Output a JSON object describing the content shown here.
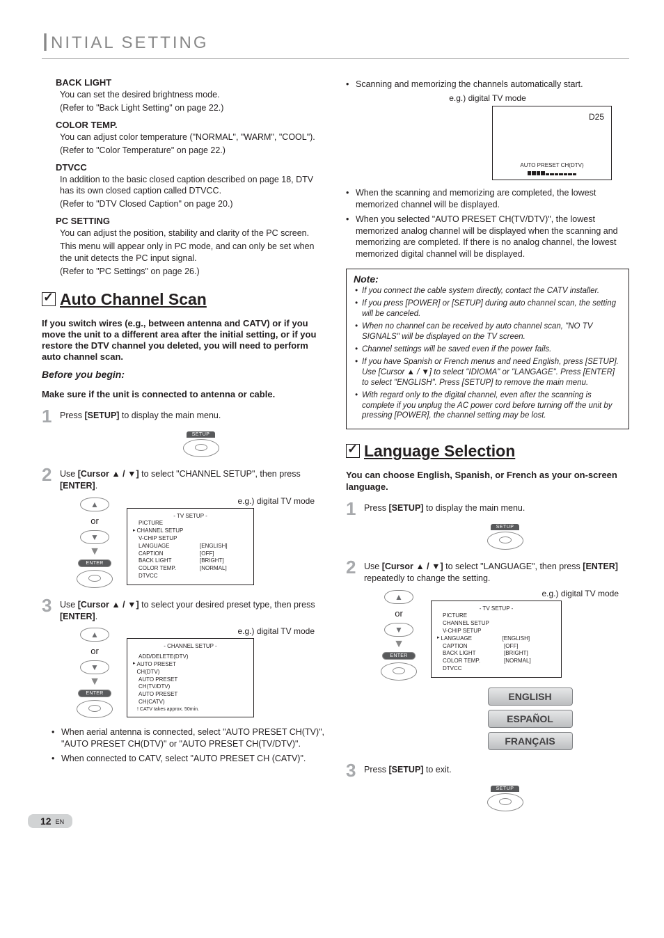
{
  "header": {
    "initial_cap": "I",
    "title_rest": "NITIAL  SETTING"
  },
  "left": {
    "backlight": {
      "head": "BACK LIGHT",
      "l1": "You can set the desired brightness mode.",
      "l2": "(Refer to \"Back Light Setting\" on page 22.)"
    },
    "colortemp": {
      "head": "COLOR TEMP.",
      "l1": "You can adjust color temperature (\"NORMAL\", \"WARM\", \"COOL\").",
      "l2": "(Refer to \"Color Temperature\" on page 22.)"
    },
    "dtvcc": {
      "head": "DTVCC",
      "l1": "In addition to the basic closed caption described on page 18, DTV has its own closed caption called DTVCC.",
      "l2": "(Refer to \"DTV Closed Caption\" on page 20.)"
    },
    "pcsetting": {
      "head": "PC SETTING",
      "l1": "You can adjust the position, stability and clarity of the PC screen.",
      "l2": "This menu will appear only in PC mode, and can only be set when the unit detects the PC input signal.",
      "l3": "(Refer to \"PC Settings\" on page 26.)"
    },
    "autoscan": {
      "title": "Auto Channel Scan",
      "intro": "If you switch wires (e.g., between antenna and CATV) or if you move the unit to a different area after the initial setting, or if you restore the DTV channel you deleted, you will need to perform auto channel scan.",
      "before_head": "Before you begin:",
      "before_text": "Make sure if the unit is connected to antenna or cable.",
      "step1": "Press [SETUP] to display the main menu.",
      "setup_label": "SETUP",
      "step2": "Use [Cursor ▲ / ▼] to select \"CHANNEL SETUP\", then press [ENTER].",
      "or": "or",
      "enter_label": "ENTER",
      "osd_cap": "e.g.) digital TV mode",
      "osd1": {
        "title": "-  TV SETUP  -",
        "rows": [
          {
            "lab": "PICTURE",
            "val": ""
          },
          {
            "lab": "CHANNEL SETUP",
            "val": "",
            "sel": true
          },
          {
            "lab": "V-CHIP  SETUP",
            "val": ""
          },
          {
            "lab": "LANGUAGE",
            "val": "[ENGLISH]"
          },
          {
            "lab": "CAPTION",
            "val": "[OFF]"
          },
          {
            "lab": "BACK  LIGHT",
            "val": "[BRIGHT]"
          },
          {
            "lab": "COLOR  TEMP.",
            "val": "[NORMAL]"
          },
          {
            "lab": "DTVCC",
            "val": ""
          }
        ]
      },
      "step3": "Use [Cursor ▲ / ▼] to select your desired preset type, then press [ENTER].",
      "osd2": {
        "title": "- CHANNEL SETUP -",
        "rows": [
          {
            "lab": "ADD/DELETE(DTV)",
            "val": ""
          },
          {
            "lab": "AUTO PRESET CH(DTV)",
            "val": "",
            "sel": true
          },
          {
            "lab": "AUTO PRESET CH(TV/DTV)",
            "val": ""
          },
          {
            "lab": "AUTO PRESET CH(CATV)",
            "val": ""
          }
        ],
        "remark": "! CATV takes approx. 50min."
      },
      "bullets": [
        "When aerial antenna is connected, select \"AUTO PRESET CH(TV)\", \"AUTO PRESET CH(DTV)\" or \"AUTO PRESET CH(TV/DTV)\".",
        "When connected to CATV, select \"AUTO PRESET CH (CATV)\"."
      ]
    }
  },
  "right": {
    "top_bullet": "Scanning and memorizing the channels automatically start.",
    "tv_cap": "e.g.) digital TV mode",
    "tv": {
      "ch": "D25",
      "label": "AUTO PRESET CH(DTV)"
    },
    "after_bullets": [
      "When the scanning and memorizing are completed, the lowest memorized channel will be displayed.",
      "When you selected \"AUTO PRESET CH(TV/DTV)\", the lowest memorized analog channel will be displayed when the scanning and memorizing are completed. If there is no analog channel, the lowest memorized digital channel will be displayed."
    ],
    "note": {
      "head": "Note:",
      "items": [
        "If you connect the cable system directly, contact the CATV installer.",
        "If you press [POWER] or [SETUP] during auto channel scan, the setting will be canceled.",
        "When no channel can be received by auto channel scan, \"NO TV SIGNALS\" will be displayed on the TV screen.",
        "Channel settings will be saved even if the power fails.",
        "If you have Spanish or French menus and need English, press [SETUP]. Use [Cursor ▲ / ▼] to select \"IDIOMA\" or \"LANGAGE\". Press [ENTER] to select \"ENGLISH\". Press [SETUP] to remove the main menu.",
        "With regard only to the digital channel, even after the scanning is complete if you unplug the AC power cord before turning off the unit by pressing [POWER], the channel setting may be lost."
      ]
    },
    "lang": {
      "title": "Language Selection",
      "intro": "You can choose English, Spanish, or French as your on-screen language.",
      "step1": "Press [SETUP] to display the main menu.",
      "step2": "Use [Cursor ▲ / ▼] to select \"LANGUAGE\", then press [ENTER] repeatedly to change the setting.",
      "osd_cap": "e.g.) digital TV mode",
      "osd": {
        "title": "-  TV SETUP  -",
        "rows": [
          {
            "lab": "PICTURE",
            "val": ""
          },
          {
            "lab": "CHANNEL SETUP",
            "val": ""
          },
          {
            "lab": "V-CHIP  SETUP",
            "val": ""
          },
          {
            "lab": "LANGUAGE",
            "val": "[ENGLISH]",
            "sel": true
          },
          {
            "lab": "CAPTION",
            "val": "[OFF]"
          },
          {
            "lab": "BACK  LIGHT",
            "val": "[BRIGHT]"
          },
          {
            "lab": "COLOR  TEMP.",
            "val": "[NORMAL]"
          },
          {
            "lab": "DTVCC",
            "val": ""
          }
        ]
      },
      "btns": [
        "ENGLISH",
        "ESPAÑOL",
        "FRANÇAIS"
      ],
      "step3": "Press [SETUP] to exit."
    }
  },
  "page_num": "12",
  "page_en": "EN"
}
